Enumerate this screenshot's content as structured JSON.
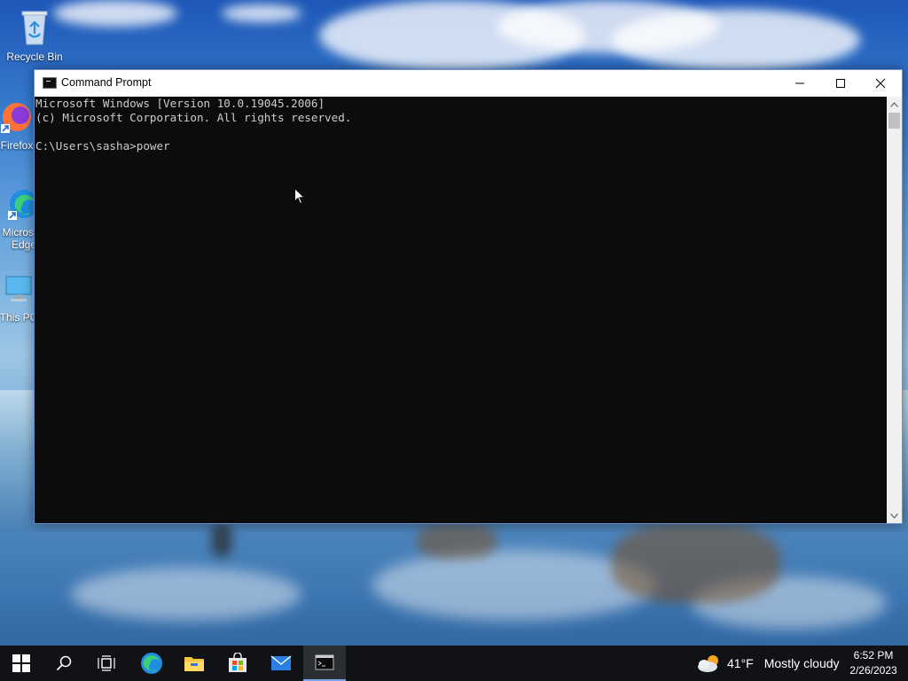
{
  "desktop": {
    "icons": [
      {
        "label": "Recycle Bin"
      },
      {
        "label": "Firefox"
      },
      {
        "label": "Microsoft Edge"
      },
      {
        "label": "This PC"
      }
    ]
  },
  "window": {
    "title": "Command Prompt",
    "console_lines": [
      "Microsoft Windows [Version 10.0.19045.2006]",
      "(c) Microsoft Corporation. All rights reserved.",
      "",
      "C:\\Users\\sasha>power"
    ]
  },
  "taskbar": {
    "apps": [
      {
        "name": "start",
        "icon": "windows-logo-icon"
      },
      {
        "name": "search",
        "icon": "search-icon"
      },
      {
        "name": "task-view",
        "icon": "task-view-icon"
      },
      {
        "name": "edge",
        "icon": "edge-icon"
      },
      {
        "name": "file-explorer",
        "icon": "folder-icon"
      },
      {
        "name": "store",
        "icon": "store-icon"
      },
      {
        "name": "mail",
        "icon": "mail-icon"
      },
      {
        "name": "command-prompt",
        "icon": "cmd-icon",
        "active": true
      }
    ],
    "weather": {
      "temp": "41°F",
      "condition": "Mostly cloudy",
      "icon": "partly-cloudy-icon"
    },
    "clock": {
      "time": "6:52 PM",
      "date": "2/26/2023"
    }
  },
  "colors": {
    "console_bg": "#0c0c0c",
    "console_text": "#cccccc",
    "taskbar_bg": "#101215",
    "accent": "#7aa7e8"
  }
}
